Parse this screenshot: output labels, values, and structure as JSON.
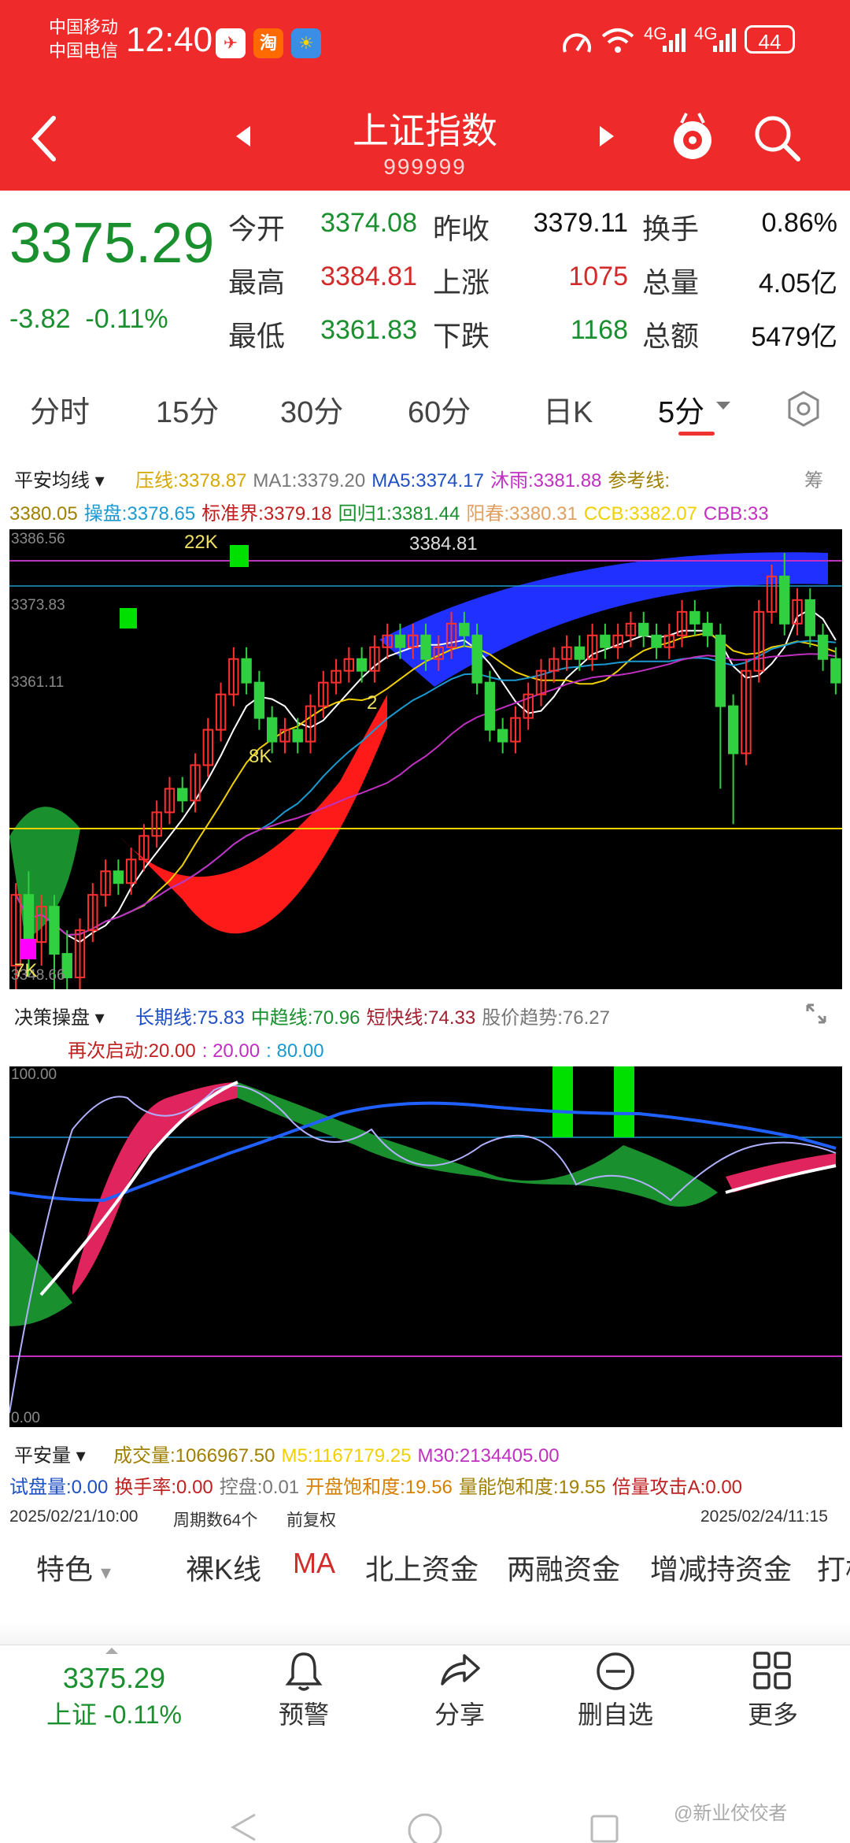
{
  "status_bar": {
    "carrier1": "中国移动",
    "carrier2": "中国电信",
    "time": "12:40",
    "app1": "淘",
    "net1": "4G",
    "net2": "4G",
    "battery": "44"
  },
  "header": {
    "title": "上证指数",
    "code": "999999"
  },
  "quote": {
    "price": "3375.29",
    "change": "-3.82",
    "change_pct": "-0.11%",
    "rows": [
      [
        {
          "label": "今开",
          "value": "3374.08",
          "color": "green"
        },
        {
          "label": "昨收",
          "value": "3379.11",
          "color": "blk"
        },
        {
          "label": "换手",
          "value": "0.86%",
          "color": "blk"
        }
      ],
      [
        {
          "label": "最高",
          "value": "3384.81",
          "color": "red"
        },
        {
          "label": "上涨",
          "value": "1075",
          "color": "red"
        },
        {
          "label": "总量",
          "value": "4.05亿",
          "color": "blk"
        }
      ],
      [
        {
          "label": "最低",
          "value": "3361.83",
          "color": "green"
        },
        {
          "label": "下跌",
          "value": "1168",
          "color": "green"
        },
        {
          "label": "总额",
          "value": "5479亿",
          "color": "blk"
        }
      ]
    ]
  },
  "tabs": {
    "t0": "分时",
    "t1": "15分",
    "t2": "30分",
    "t3": "60分",
    "t4": "日K",
    "t5": "5分"
  },
  "main_ind": {
    "name": "平安均线",
    "l1": [
      {
        "t": "压线:3378.87",
        "c": "#d6a800"
      },
      {
        "t": "MA1:3379.20",
        "c": "#777"
      },
      {
        "t": "MA5:3374.17",
        "c": "#1f4fc4"
      },
      {
        "t": "沐雨:3381.88",
        "c": "#c030c0"
      },
      {
        "t": "参考线:",
        "c": "#a08000"
      }
    ],
    "trail": "筹",
    "l2": [
      {
        "t": "3380.05",
        "c": "#a08000"
      },
      {
        "t": "操盘:3378.65",
        "c": "#1a9ad0"
      },
      {
        "t": "标准界:3379.18",
        "c": "#c02020"
      },
      {
        "t": "回归1:3381.44",
        "c": "#1a8f2e"
      },
      {
        "t": "阳春:3380.31",
        "c": "#e0a060"
      },
      {
        "t": "CCB:3382.07",
        "c": "#f0d000"
      },
      {
        "t": "CBB:33",
        "c": "#c030c0"
      }
    ]
  },
  "chart_data": {
    "type": "candlestick",
    "y_ticks": [
      "3386.56",
      "3373.83",
      "3361.11",
      "3348.66"
    ],
    "candles": [
      [
        3350,
        3356,
        3347,
        3357
      ],
      [
        3356,
        3352,
        3349,
        3358
      ],
      [
        3352,
        3355,
        3350,
        3356
      ],
      [
        3355,
        3351,
        3348,
        3356
      ],
      [
        3351,
        3349,
        3347,
        3353
      ],
      [
        3349,
        3353,
        3348,
        3354
      ],
      [
        3353,
        3356,
        3352,
        3357
      ],
      [
        3356,
        3358,
        3355,
        3359
      ],
      [
        3358,
        3357,
        3356,
        3359
      ],
      [
        3357,
        3359,
        3356,
        3360
      ],
      [
        3359,
        3361,
        3358,
        3362
      ],
      [
        3361,
        3363,
        3360,
        3364
      ],
      [
        3363,
        3365,
        3362,
        3366
      ],
      [
        3365,
        3364,
        3363,
        3366
      ],
      [
        3364,
        3367,
        3363,
        3368
      ],
      [
        3367,
        3370,
        3366,
        3371
      ],
      [
        3370,
        3373,
        3369,
        3374
      ],
      [
        3373,
        3376,
        3372,
        3377
      ],
      [
        3376,
        3374,
        3373,
        3377
      ],
      [
        3374,
        3371,
        3370,
        3375
      ],
      [
        3371,
        3369,
        3368,
        3372
      ],
      [
        3369,
        3370,
        3368,
        3371
      ],
      [
        3370,
        3369,
        3368,
        3371
      ],
      [
        3369,
        3372,
        3368,
        3373
      ],
      [
        3372,
        3374,
        3371,
        3375
      ],
      [
        3374,
        3375,
        3373,
        3376
      ],
      [
        3375,
        3376,
        3374,
        3377
      ],
      [
        3376,
        3375,
        3374,
        3377
      ],
      [
        3375,
        3377,
        3374,
        3378
      ],
      [
        3377,
        3378,
        3376,
        3379
      ],
      [
        3378,
        3377,
        3376,
        3379
      ],
      [
        3377,
        3378,
        3376,
        3379
      ],
      [
        3378,
        3376,
        3375,
        3379
      ],
      [
        3376,
        3377,
        3375,
        3378
      ],
      [
        3377,
        3379,
        3376,
        3380
      ],
      [
        3379,
        3378,
        3377,
        3380
      ],
      [
        3378,
        3374,
        3373,
        3379
      ],
      [
        3374,
        3370,
        3369,
        3375
      ],
      [
        3370,
        3369,
        3368,
        3371
      ],
      [
        3369,
        3371,
        3368,
        3372
      ],
      [
        3371,
        3373,
        3370,
        3374
      ],
      [
        3373,
        3375,
        3372,
        3376
      ],
      [
        3375,
        3376,
        3374,
        3377
      ],
      [
        3376,
        3377,
        3375,
        3378
      ],
      [
        3377,
        3376,
        3375,
        3378
      ],
      [
        3376,
        3378,
        3375,
        3379
      ],
      [
        3378,
        3377,
        3376,
        3379
      ],
      [
        3377,
        3378,
        3376,
        3379
      ],
      [
        3378,
        3379,
        3377,
        3380
      ],
      [
        3379,
        3378,
        3377,
        3380
      ],
      [
        3378,
        3377,
        3376,
        3379
      ],
      [
        3377,
        3378,
        3376,
        3379
      ],
      [
        3378,
        3380,
        3377,
        3381
      ],
      [
        3380,
        3379,
        3378,
        3381
      ],
      [
        3379,
        3378,
        3377,
        3380
      ],
      [
        3378,
        3372,
        3365,
        3379
      ],
      [
        3372,
        3368,
        3362,
        3373
      ],
      [
        3368,
        3375,
        3367,
        3376
      ],
      [
        3375,
        3380,
        3374,
        3381
      ],
      [
        3380,
        3383,
        3379,
        3384
      ],
      [
        3383,
        3379,
        3378,
        3385
      ],
      [
        3379,
        3381,
        3378,
        3382
      ],
      [
        3381,
        3378,
        3377,
        3382
      ],
      [
        3378,
        3376,
        3375,
        3379
      ],
      [
        3376,
        3374,
        3373,
        3377
      ]
    ],
    "ymin": 3348,
    "ymax": 3387
  },
  "chart_labels": {
    "k22": "22K",
    "k8": "8K",
    "k7": "7K",
    "k2": "2",
    "hi": "3384.81"
  },
  "sub_ind": {
    "name": "决策操盘",
    "l1": [
      {
        "t": "长期线:75.83",
        "c": "#1f4fc4"
      },
      {
        "t": "中趋线:70.96",
        "c": "#1a8f2e"
      },
      {
        "t": "短快线:74.33",
        "c": "#a02030"
      },
      {
        "t": "股价趋势:76.27",
        "c": "#777"
      }
    ],
    "l2": [
      {
        "t": "再次启动:20.00",
        "c": "#c02020"
      },
      {
        "t": ": 20.00",
        "c": "#c030c0"
      },
      {
        "t": ": 80.00",
        "c": "#1a9ad0"
      }
    ],
    "y_top": "100.00",
    "y_bot": "0.00"
  },
  "vol_ind": {
    "name": "平安量",
    "l1": [
      {
        "t": "成交量:1066967.50",
        "c": "#a08000"
      },
      {
        "t": "M5:1167179.25",
        "c": "#f0d000"
      },
      {
        "t": "M30:2134405.00",
        "c": "#c030c0"
      }
    ],
    "l2": [
      {
        "t": "试盘量:0.00",
        "c": "#1f4fc4"
      },
      {
        "t": "换手率:0.00",
        "c": "#c02020"
      },
      {
        "t": "控盘:0.01",
        "c": "#777"
      },
      {
        "t": "开盘饱和度:19.56",
        "c": "#d68000"
      },
      {
        "t": "量能饱和度:19.55",
        "c": "#a08000"
      },
      {
        "t": "倍量攻击A:0.00",
        "c": "#c02020"
      }
    ]
  },
  "footer": {
    "start": "2025/02/21/10:00",
    "cycles": "周期数64个",
    "adj": "前复权",
    "end": "2025/02/24/11:15"
  },
  "subtabs": {
    "s0": "特色",
    "s1": "裸K线",
    "s2": "MA",
    "s3": "北上资金",
    "s4": "两融资金",
    "s5": "增减持资金",
    "s6": "打板"
  },
  "bottom": {
    "price": "3375.29",
    "label": "上证 -0.11%",
    "alert": "预警",
    "share": "分享",
    "remove": "删自选",
    "more": "更多"
  },
  "watermark": "@新业佼佼者"
}
